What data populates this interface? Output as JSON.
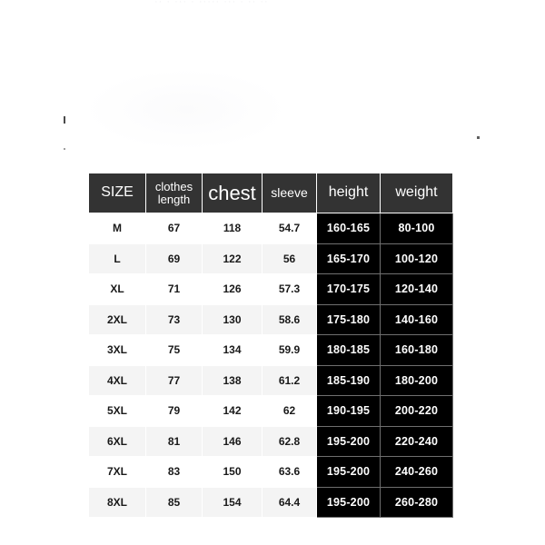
{
  "page": {
    "background_color": "#ffffff",
    "ghost_header_text": "·· · ··· · ····· ··· · ·· ··"
  },
  "table": {
    "name": "size-chart",
    "header_bg": "#333333",
    "header_text_color": "#ffffff",
    "dark_cell_bg": "#000000",
    "dark_cell_text_color": "#ffffff",
    "row_alt_bg": "#f4f4f4",
    "row_bg": "#ffffff",
    "columns": [
      {
        "key": "size",
        "label": "SIZE",
        "dark": false
      },
      {
        "key": "length",
        "label": "clothes length",
        "dark": false
      },
      {
        "key": "chest",
        "label": "chest",
        "dark": false
      },
      {
        "key": "sleeve",
        "label": "sleeve",
        "dark": false
      },
      {
        "key": "height",
        "label": "height",
        "dark": true
      },
      {
        "key": "weight",
        "label": "weight",
        "dark": true
      }
    ],
    "rows": [
      {
        "size": "M",
        "length": "67",
        "chest": "118",
        "sleeve": "54.7",
        "height": "160-165",
        "weight": "80-100"
      },
      {
        "size": "L",
        "length": "69",
        "chest": "122",
        "sleeve": "56",
        "height": "165-170",
        "weight": "100-120"
      },
      {
        "size": "XL",
        "length": "71",
        "chest": "126",
        "sleeve": "57.3",
        "height": "170-175",
        "weight": "120-140"
      },
      {
        "size": "2XL",
        "length": "73",
        "chest": "130",
        "sleeve": "58.6",
        "height": "175-180",
        "weight": "140-160"
      },
      {
        "size": "3XL",
        "length": "75",
        "chest": "134",
        "sleeve": "59.9",
        "height": "180-185",
        "weight": "160-180"
      },
      {
        "size": "4XL",
        "length": "77",
        "chest": "138",
        "sleeve": "61.2",
        "height": "185-190",
        "weight": "180-200"
      },
      {
        "size": "5XL",
        "length": "79",
        "chest": "142",
        "sleeve": "62",
        "height": "190-195",
        "weight": "200-220"
      },
      {
        "size": "6XL",
        "length": "81",
        "chest": "146",
        "sleeve": "62.8",
        "height": "195-200",
        "weight": "220-240"
      },
      {
        "size": "7XL",
        "length": "83",
        "chest": "150",
        "sleeve": "63.6",
        "height": "195-200",
        "weight": "240-260"
      },
      {
        "size": "8XL",
        "length": "85",
        "chest": "154",
        "sleeve": "64.4",
        "height": "195-200",
        "weight": "260-280"
      }
    ]
  }
}
